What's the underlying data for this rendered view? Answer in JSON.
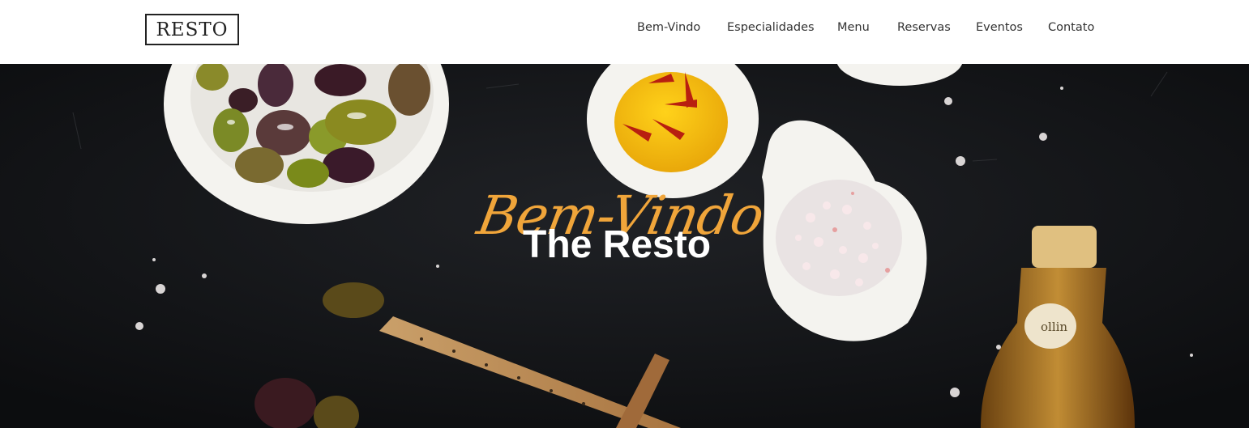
{
  "brand": {
    "logo_text": "RESTO"
  },
  "nav": {
    "items": [
      {
        "label": "Bem-Vindo"
      },
      {
        "label": "Especialidades"
      },
      {
        "label": "Menu"
      },
      {
        "label": "Reservas"
      },
      {
        "label": "Eventos"
      },
      {
        "label": "Contato"
      }
    ]
  },
  "hero": {
    "script_text": "Bem-Vindo",
    "title": "The Resto",
    "bottle_label": "ollin",
    "colors": {
      "script": "#f0a53a",
      "title": "#ffffff",
      "background": "#131416"
    }
  }
}
